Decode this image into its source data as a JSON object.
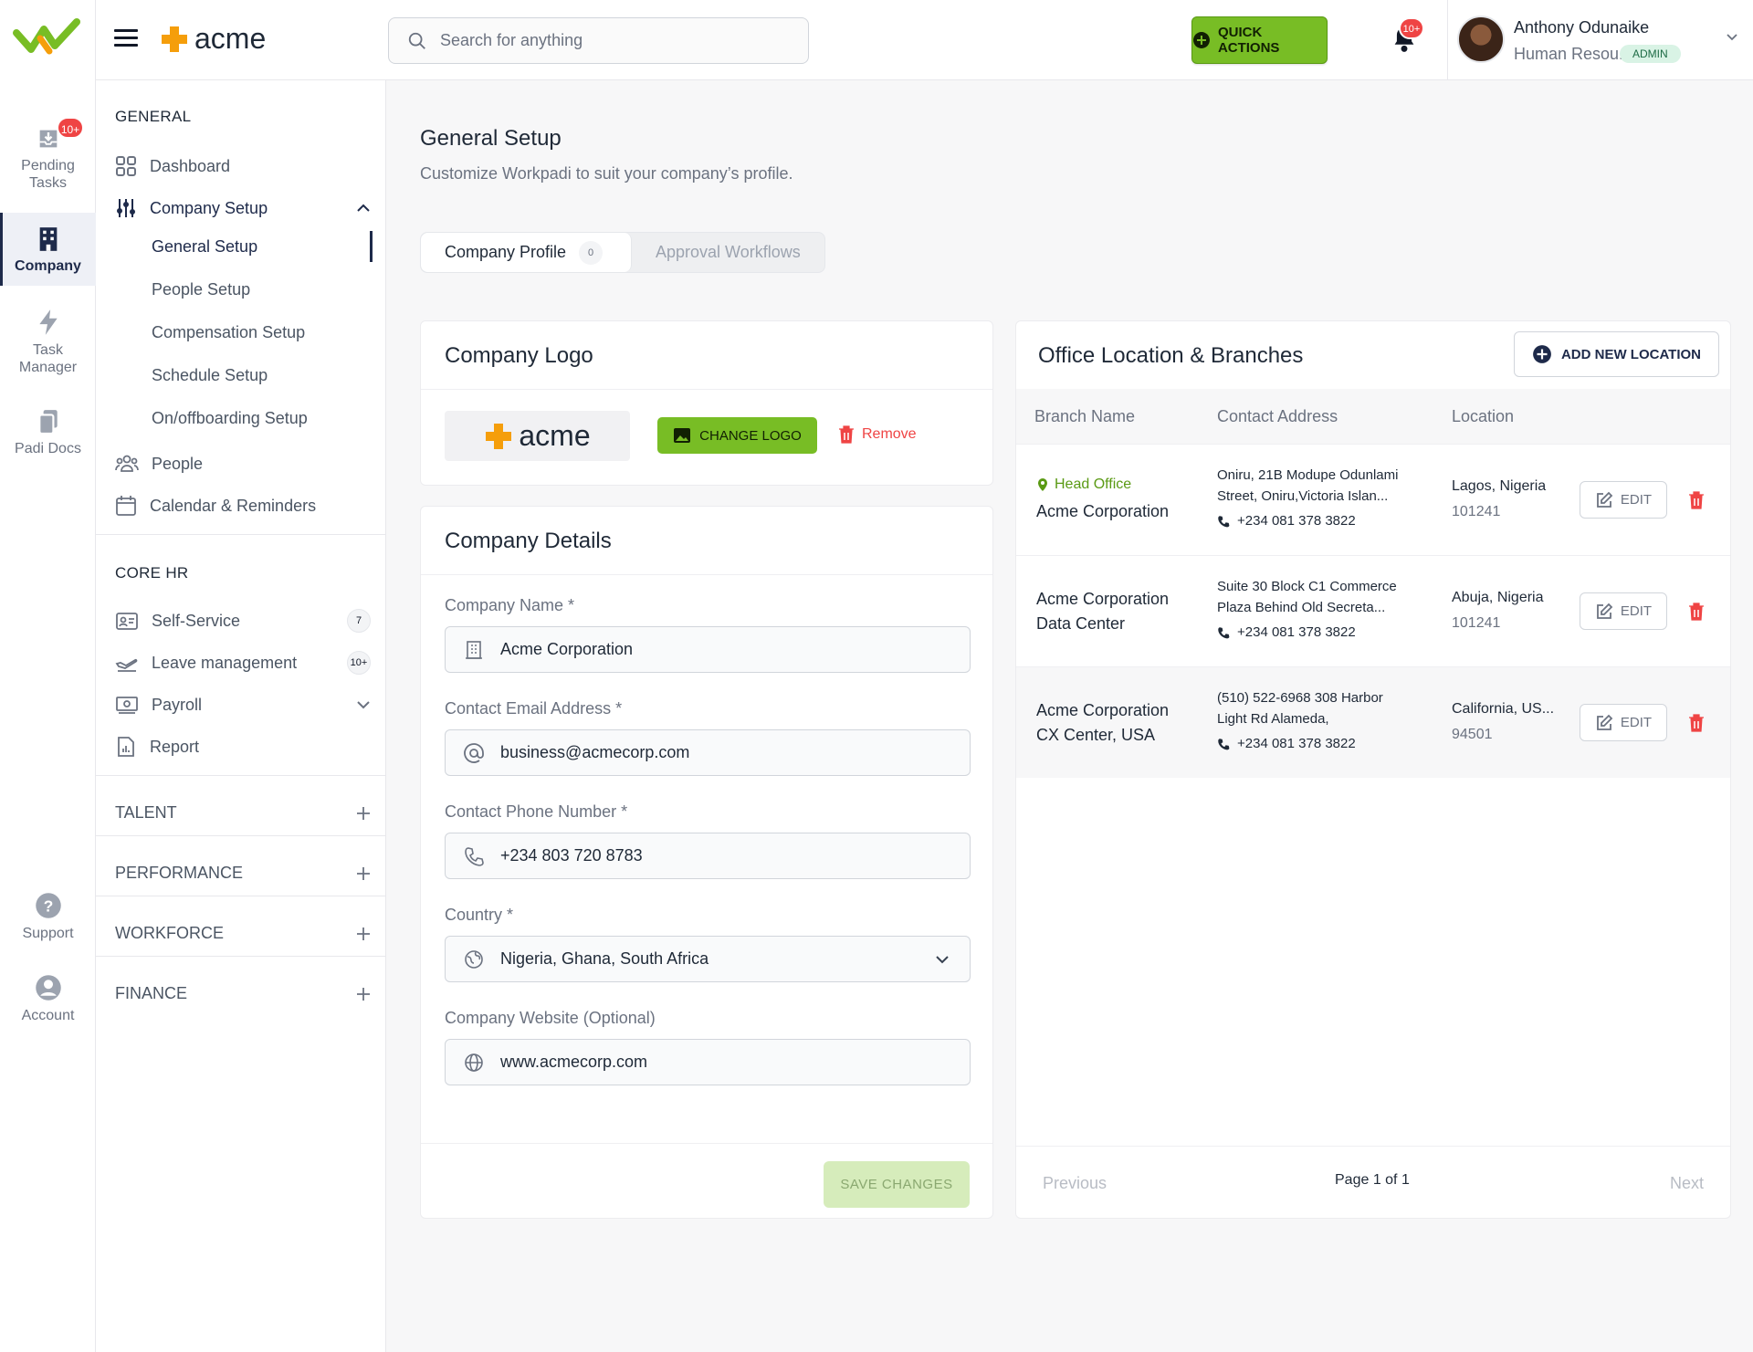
{
  "brand": {
    "name": "acme",
    "accent": "#78bd25",
    "navy": "#1e2a4a",
    "orange": "#f59e0b"
  },
  "rail": {
    "pending_tasks": "Pending Tasks",
    "pending_badge": "10+",
    "company": "Company",
    "task_manager": "Task Manager",
    "padi_docs": "Padi Docs",
    "support": "Support",
    "account": "Account"
  },
  "header": {
    "search_placeholder": "Search for anything",
    "quick_actions": "QUICK ACTIONS",
    "bell_badge": "10+",
    "user_name": "Anthony Odunaike",
    "user_role": "Human Resou...",
    "user_badge": "ADMIN"
  },
  "sidebar": {
    "general_title": "GENERAL",
    "dashboard": "Dashboard",
    "company_setup": "Company Setup",
    "sub": [
      "General Setup",
      "People Setup",
      "Compensation Setup",
      "Schedule Setup",
      "On/offboarding Setup"
    ],
    "people": "People",
    "calendar": "Calendar & Reminders",
    "core_hr_title": "CORE HR",
    "self_service": "Self-Service",
    "self_service_count": "7",
    "leave": "Leave management",
    "leave_count": "10+",
    "payroll": "Payroll",
    "report": "Report",
    "groups": [
      "TALENT",
      "PERFORMANCE",
      "WORKFORCE",
      "FINANCE"
    ]
  },
  "page": {
    "title": "General Setup",
    "subtitle": "Customize Workpadi to suit your company’s profile.",
    "tabs": [
      {
        "label": "Company Profile",
        "count": "0"
      },
      {
        "label": "Approval Workflows"
      }
    ]
  },
  "logo_card": {
    "title": "Company Logo",
    "change": "CHANGE LOGO",
    "remove": "Remove"
  },
  "details_card": {
    "title": "Company Details",
    "fields": [
      {
        "label": "Company Name *",
        "value": "Acme Corporation",
        "icon": "building-icon"
      },
      {
        "label": "Contact Email Address *",
        "value": "business@acmecorp.com",
        "icon": "at-icon"
      },
      {
        "label": "Contact Phone Number *",
        "value": "+234 803 720 8783",
        "icon": "phone-icon"
      },
      {
        "label": "Country *",
        "value": "Nigeria, Ghana, South Africa",
        "icon": "globe-icon"
      },
      {
        "label": "Company Website (Optional)",
        "value": "www.acmecorp.com",
        "icon": "web-icon"
      }
    ],
    "save": "SAVE CHANGES"
  },
  "locations": {
    "title": "Office Location & Branches",
    "add": "ADD NEW LOCATION",
    "headers": [
      "Branch Name",
      "Contact Address",
      "Location"
    ],
    "rows": [
      {
        "tag": "Head Office",
        "name1": "Acme Corporation",
        "name2": "",
        "addr1": "Oniru, 21B Modupe Odunlami",
        "addr2": "Street, Oniru,Victoria Islan...",
        "phone": "+234 081 378 3822",
        "city": "Lagos, Nigeria",
        "zip": "101241"
      },
      {
        "tag": "",
        "name1": "Acme Corporation",
        "name2": "Data Center",
        "addr1": "Suite 30 Block C1 Commerce",
        "addr2": "Plaza Behind Old Secreta...",
        "phone": "+234 081 378 3822",
        "city": "Abuja, Nigeria",
        "zip": "101241"
      },
      {
        "tag": "",
        "name1": "Acme Corporation",
        "name2": "CX Center, USA",
        "addr1": "(510) 522-6968 308 Harbor",
        "addr2": "Light Rd Alameda,",
        "phone": "+234 081 378 3822",
        "city": "California, US...",
        "zip": "94501"
      }
    ],
    "edit": "EDIT",
    "prev": "Previous",
    "page_info": "Page 1 of 1",
    "next": "Next"
  }
}
